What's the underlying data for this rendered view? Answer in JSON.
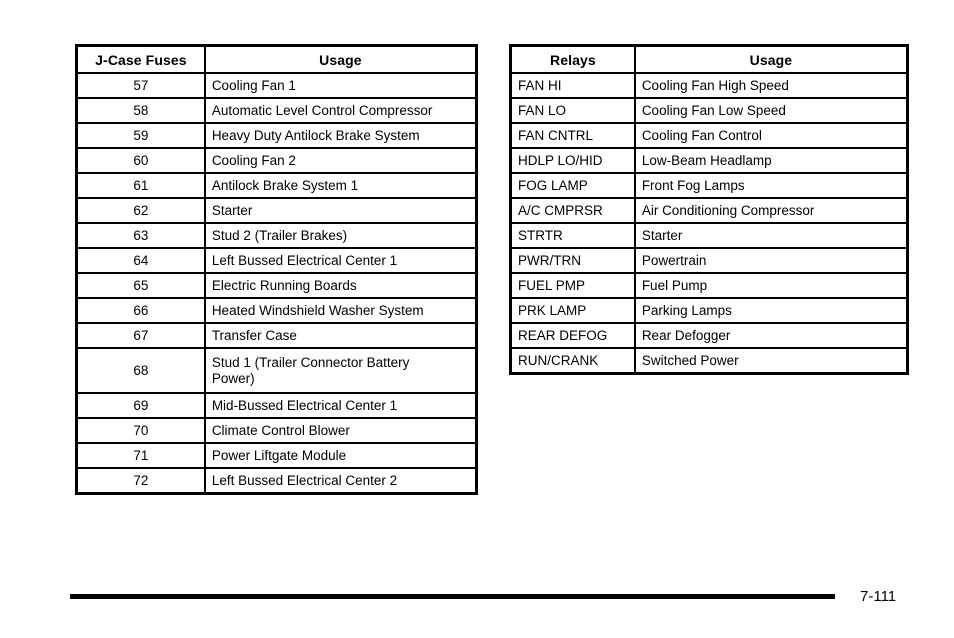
{
  "document": {
    "page_number": "7-111"
  },
  "tables": {
    "jcase": {
      "headers": {
        "key": "J-Case Fuses",
        "usage": "Usage"
      },
      "rows": [
        {
          "key": "57",
          "usage": "Cooling Fan 1"
        },
        {
          "key": "58",
          "usage": "Automatic Level Control Compressor"
        },
        {
          "key": "59",
          "usage": "Heavy Duty Antilock Brake System"
        },
        {
          "key": "60",
          "usage": "Cooling Fan 2"
        },
        {
          "key": "61",
          "usage": "Antilock Brake System 1"
        },
        {
          "key": "62",
          "usage": "Starter"
        },
        {
          "key": "63",
          "usage": "Stud 2 (Trailer Brakes)"
        },
        {
          "key": "64",
          "usage": "Left Bussed Electrical Center 1"
        },
        {
          "key": "65",
          "usage": "Electric Running Boards"
        },
        {
          "key": "66",
          "usage": "Heated Windshield Washer System"
        },
        {
          "key": "67",
          "usage": "Transfer Case"
        },
        {
          "key": "68",
          "usage": "Stud 1 (Trailer Connector Battery Power)"
        },
        {
          "key": "69",
          "usage": "Mid-Bussed Electrical Center 1"
        },
        {
          "key": "70",
          "usage": "Climate Control Blower"
        },
        {
          "key": "71",
          "usage": "Power Liftgate Module"
        },
        {
          "key": "72",
          "usage": "Left Bussed Electrical Center 2"
        }
      ]
    },
    "relays": {
      "headers": {
        "key": "Relays",
        "usage": "Usage"
      },
      "rows": [
        {
          "key": "FAN HI",
          "usage": "Cooling Fan High Speed"
        },
        {
          "key": "FAN LO",
          "usage": "Cooling Fan Low Speed"
        },
        {
          "key": "FAN CNTRL",
          "usage": "Cooling Fan Control"
        },
        {
          "key": "HDLP LO/HID",
          "usage": "Low-Beam Headlamp"
        },
        {
          "key": "FOG LAMP",
          "usage": "Front Fog Lamps"
        },
        {
          "key": "A/C CMPRSR",
          "usage": "Air Conditioning Compressor"
        },
        {
          "key": "STRTR",
          "usage": "Starter"
        },
        {
          "key": "PWR/TRN",
          "usage": "Powertrain"
        },
        {
          "key": "FUEL PMP",
          "usage": "Fuel Pump"
        },
        {
          "key": "PRK LAMP",
          "usage": "Parking Lamps"
        },
        {
          "key": "REAR DEFOG",
          "usage": "Rear Defogger"
        },
        {
          "key": "RUN/CRANK",
          "usage": "Switched Power"
        }
      ]
    }
  }
}
